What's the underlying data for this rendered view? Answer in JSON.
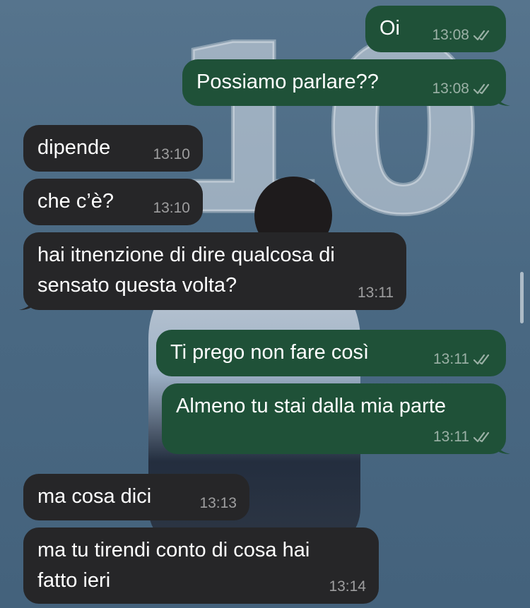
{
  "chat": {
    "messages": [
      {
        "dir": "out",
        "text": "Oi",
        "time": "13:08",
        "status": "read"
      },
      {
        "dir": "out",
        "text": "Possiamo parlare??",
        "time": "13:08",
        "status": "read"
      },
      {
        "dir": "in",
        "text": "dipende",
        "time": "13:10"
      },
      {
        "dir": "in",
        "text": "che c’è?",
        "time": "13:10"
      },
      {
        "dir": "in",
        "text": "hai itnenzione di dire qualcosa di",
        "text2": "sensato questa volta?",
        "time": "13:11"
      },
      {
        "dir": "out",
        "text": "Ti prego non fare così",
        "time": "13:11",
        "status": "read"
      },
      {
        "dir": "out",
        "text": "Almeno tu stai dalla mia parte",
        "time": "13:11",
        "status": "read"
      },
      {
        "dir": "in",
        "text": "ma cosa dici",
        "time": "13:13"
      },
      {
        "dir": "in",
        "text": "ma tu tirendi conto di cosa hai",
        "text2": "fatto ieri",
        "time": "13:14"
      }
    ]
  },
  "wallpaper": {
    "number": "10"
  },
  "colors": {
    "incoming_bubble": "#262628",
    "outgoing_bubble": "#1f5138",
    "wallpaper": "#4d6c86"
  },
  "icons": {
    "read_receipt": "double-check-icon"
  }
}
